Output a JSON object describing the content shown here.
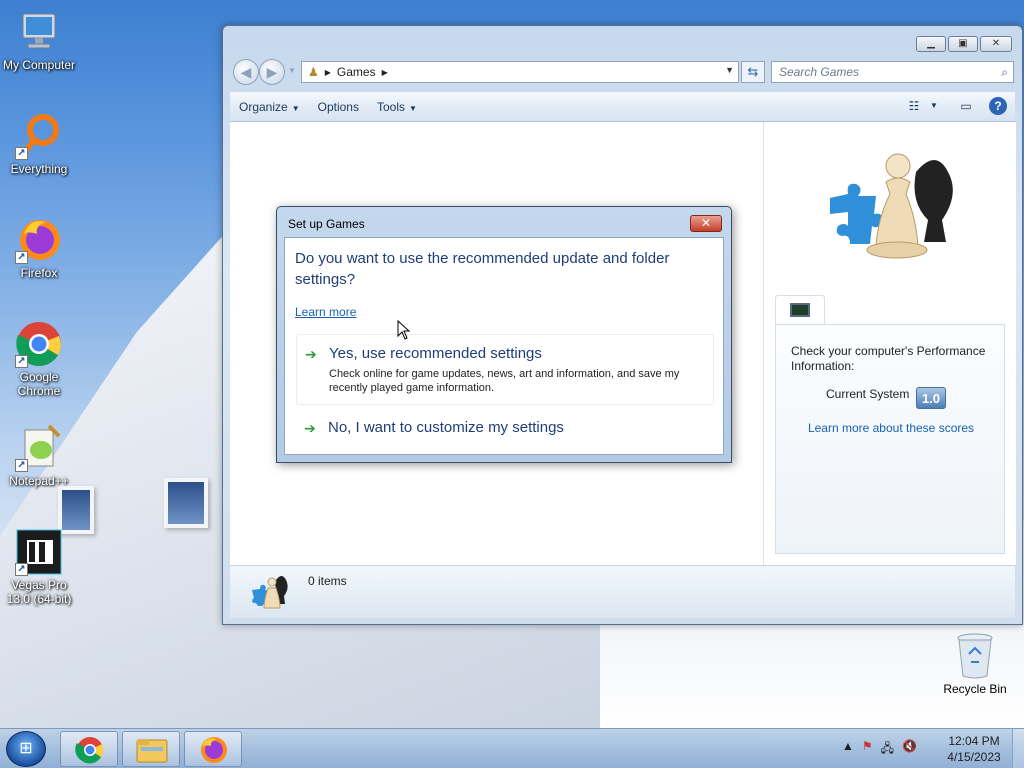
{
  "desktop": {
    "icons": [
      {
        "label": "My Computer"
      },
      {
        "label": "Everything"
      },
      {
        "label": "Firefox"
      },
      {
        "label": "Google Chrome"
      },
      {
        "label": "Notepad++"
      },
      {
        "label": "Vegas Pro 13.0 (64-bit)"
      }
    ],
    "recycle_bin": "Recycle Bin"
  },
  "window": {
    "address": {
      "crumb": "Games"
    },
    "search_placeholder": "Search Games",
    "commands": {
      "organize": "Organize",
      "options": "Options",
      "tools": "Tools"
    },
    "status_text": "0 items",
    "performance": {
      "intro": "Check your computer's Performance Information:",
      "current_label": "Current System",
      "score": "1.0",
      "link": "Learn more about these scores"
    }
  },
  "dialog": {
    "title": "Set up Games",
    "close_label": "✕",
    "question": "Do you want to use the recommended update and folder settings?",
    "learn_more": "Learn more",
    "option_recommended": {
      "title": "Yes, use recommended settings",
      "description": "Check online for game updates, news, art and information, and save my recently played game information."
    },
    "option_custom": {
      "title": "No, I want to customize my settings"
    }
  },
  "taskbar": {
    "time": "12:04 PM",
    "date": "4/15/2023"
  },
  "colors": {
    "accent_link": "#1760b3",
    "dialog_heading": "#1e3d78",
    "option_arrow": "#2a9a3a"
  }
}
